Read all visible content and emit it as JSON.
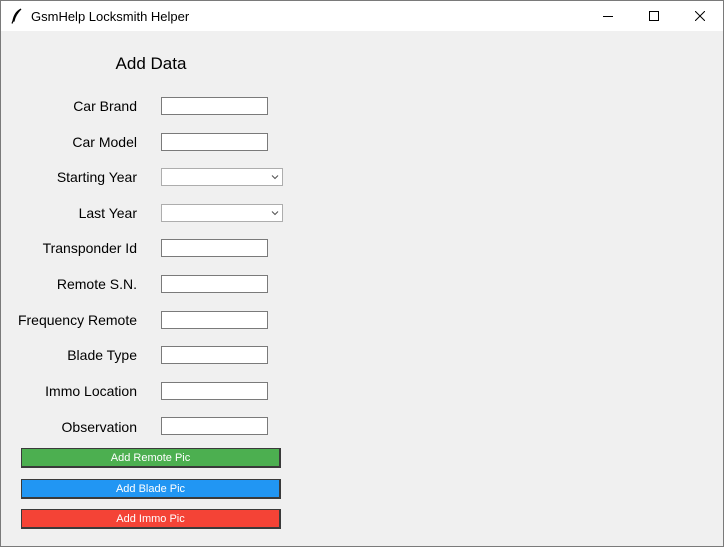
{
  "window": {
    "title": "GsmHelp Locksmith Helper",
    "app_icon": "feather-icon"
  },
  "form": {
    "heading": "Add Data",
    "fields": [
      {
        "label": "Car Brand",
        "type": "entry",
        "value": ""
      },
      {
        "label": "Car Model",
        "type": "entry",
        "value": ""
      },
      {
        "label": "Starting Year",
        "type": "combobox",
        "value": ""
      },
      {
        "label": "Last Year",
        "type": "combobox",
        "value": ""
      },
      {
        "label": "Transponder Id",
        "type": "entry",
        "value": ""
      },
      {
        "label": "Remote S.N.",
        "type": "entry",
        "value": ""
      },
      {
        "label": "Frequency Remote",
        "type": "entry",
        "value": ""
      },
      {
        "label": "Blade Type",
        "type": "entry",
        "value": ""
      },
      {
        "label": "Immo Location",
        "type": "entry",
        "value": ""
      },
      {
        "label": "Observation",
        "type": "entry",
        "value": ""
      }
    ]
  },
  "buttons": {
    "remote_pic": {
      "label": "Add Remote Pic",
      "color": "#4caf50"
    },
    "blade_pic": {
      "label": "Add Blade Pic",
      "color": "#2196f3"
    },
    "immo_pic": {
      "label": "Add Immo Pic",
      "color": "#f44336"
    }
  }
}
